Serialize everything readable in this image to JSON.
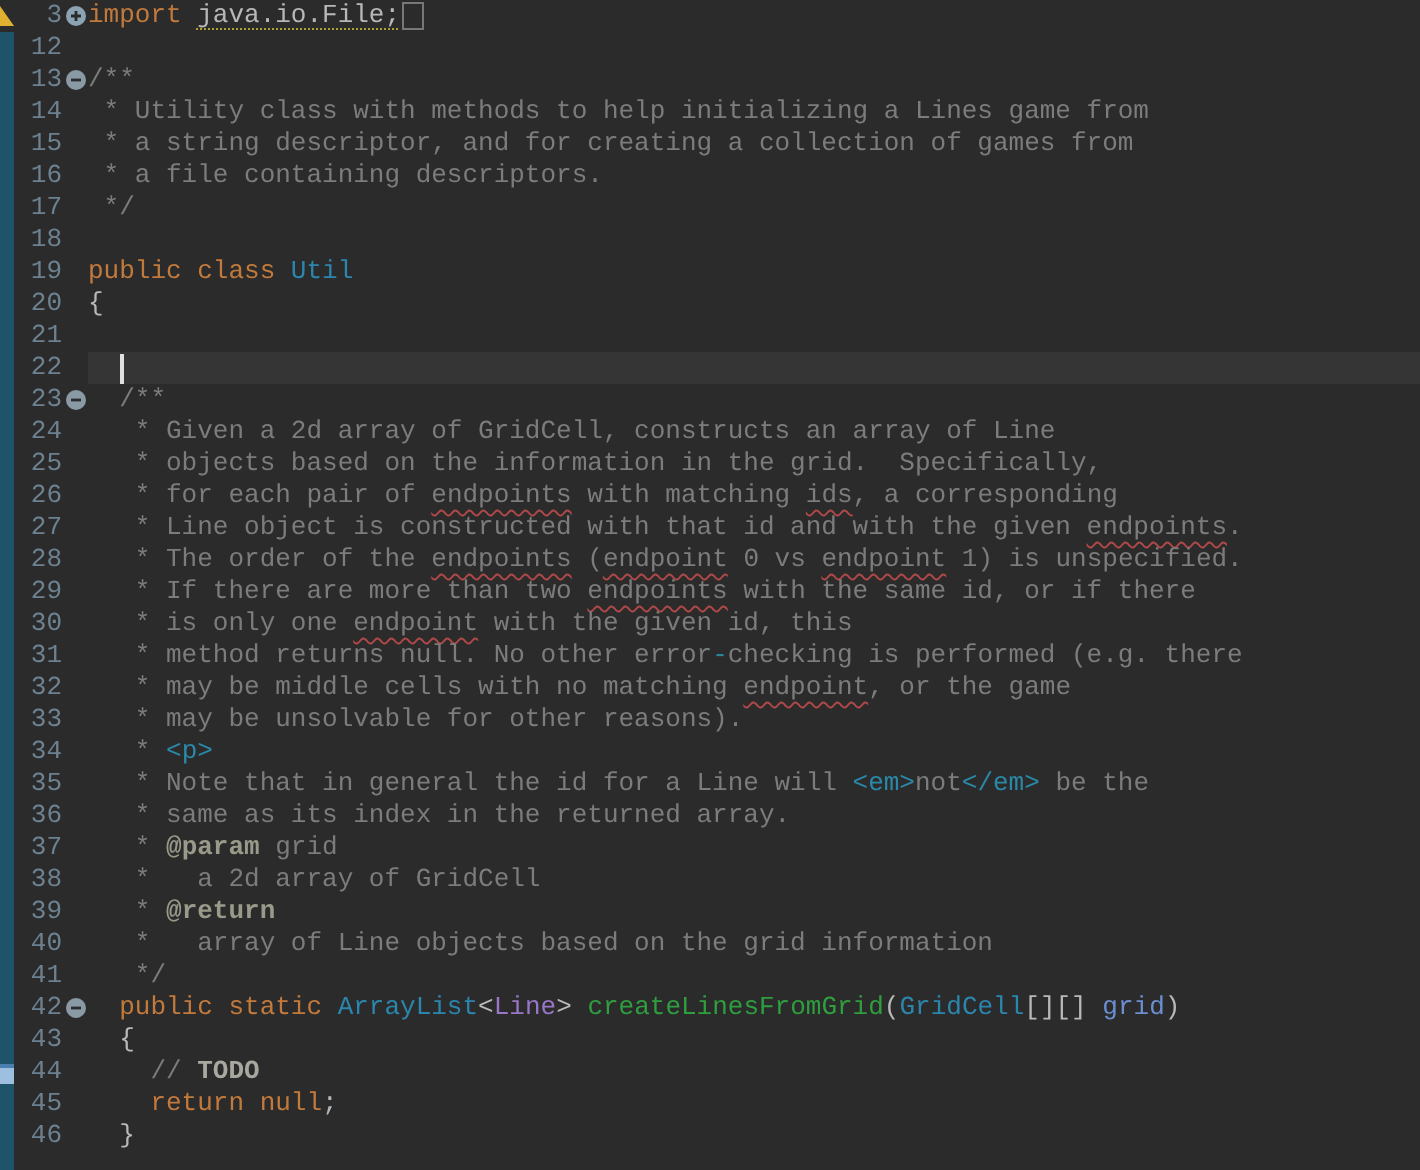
{
  "editor": {
    "lines": [
      {
        "number": "3",
        "folded": true,
        "annotation": {
          "kind": "warning"
        },
        "current": false,
        "tokens": [
          {
            "kind": "keyword",
            "text": "import "
          },
          {
            "kind": "warning",
            "text": "java.io.File;"
          }
        ]
      },
      {
        "number": "12",
        "current": false
      },
      {
        "number": "13",
        "folded": false,
        "current": false,
        "tokens": [
          {
            "kind": "comment",
            "text": "/**"
          }
        ]
      },
      {
        "number": "14",
        "current": false,
        "tokens": [
          {
            "kind": "comment",
            "text": " * Utility class with methods to help initializing a Lines game from"
          }
        ]
      },
      {
        "number": "15",
        "current": false,
        "tokens": [
          {
            "kind": "comment",
            "text": " * a string descriptor, and for creating a collection of games from"
          }
        ]
      },
      {
        "number": "16",
        "current": false,
        "tokens": [
          {
            "kind": "comment",
            "text": " * a file containing descriptors."
          }
        ]
      },
      {
        "number": "17",
        "current": false,
        "tokens": [
          {
            "kind": "comment",
            "text": " */"
          }
        ]
      },
      {
        "number": "18",
        "current": false
      },
      {
        "number": "19",
        "current": false,
        "tokens": [
          {
            "kind": "keyword",
            "text": "public class "
          },
          {
            "kind": "type",
            "text": "Util"
          }
        ]
      },
      {
        "number": "20",
        "current": false,
        "tokens": [
          {
            "kind": "plain",
            "text": "{"
          }
        ]
      },
      {
        "number": "21",
        "current": false
      },
      {
        "number": "22",
        "current": true
      },
      {
        "number": "23",
        "folded": false,
        "current": false,
        "tokens": [
          {
            "kind": "comment",
            "text": "  /**"
          }
        ]
      },
      {
        "number": "24",
        "current": false,
        "tokens": [
          {
            "kind": "comment",
            "text": "   * Given a 2d array of GridCell, constructs an array of Line"
          }
        ]
      },
      {
        "number": "25",
        "current": false,
        "tokens": [
          {
            "kind": "comment",
            "text": "   * objects based on the information in the grid.  Specifically,"
          }
        ]
      },
      {
        "number": "26",
        "current": false,
        "tokens": [
          {
            "kind": "comment",
            "text": "   * for each pair of "
          },
          {
            "kind": "misspelled",
            "text": "endpoints"
          },
          {
            "kind": "comment",
            "text": " with matching "
          },
          {
            "kind": "misspelled",
            "text": "ids"
          },
          {
            "kind": "comment",
            "text": ", a corresponding"
          }
        ]
      },
      {
        "number": "27",
        "current": false,
        "tokens": [
          {
            "kind": "comment",
            "text": "   * Line object is constructed with that id and with the given "
          },
          {
            "kind": "misspelled",
            "text": "endpoints"
          },
          {
            "kind": "comment",
            "text": "."
          }
        ]
      },
      {
        "number": "28",
        "current": false,
        "tokens": [
          {
            "kind": "comment",
            "text": "   * The order of the "
          },
          {
            "kind": "misspelled",
            "text": "endpoints"
          },
          {
            "kind": "comment",
            "text": " ("
          },
          {
            "kind": "misspelled",
            "text": "endpoint"
          },
          {
            "kind": "comment",
            "text": " 0 vs "
          },
          {
            "kind": "misspelled",
            "text": "endpoint"
          },
          {
            "kind": "comment",
            "text": " 1) is unspecified."
          }
        ]
      },
      {
        "number": "29",
        "current": false,
        "tokens": [
          {
            "kind": "comment",
            "text": "   * If there are more than two "
          },
          {
            "kind": "misspelled",
            "text": "endpoints"
          },
          {
            "kind": "comment",
            "text": " with the same id, or if there"
          }
        ]
      },
      {
        "number": "30",
        "current": false,
        "tokens": [
          {
            "kind": "comment",
            "text": "   * is only one "
          },
          {
            "kind": "misspelled",
            "text": "endpoint"
          },
          {
            "kind": "comment",
            "text": " with the given id, this"
          }
        ]
      },
      {
        "number": "31",
        "current": false,
        "tokens": [
          {
            "kind": "comment",
            "text": "   * method returns null. No other error"
          },
          {
            "kind": "tag",
            "text": "-"
          },
          {
            "kind": "comment",
            "text": "checking is performed (e.g. there"
          }
        ]
      },
      {
        "number": "32",
        "current": false,
        "tokens": [
          {
            "kind": "comment",
            "text": "   * may be middle cells with no matching "
          },
          {
            "kind": "misspelled",
            "text": "endpoint"
          },
          {
            "kind": "comment",
            "text": ", or the game"
          }
        ]
      },
      {
        "number": "33",
        "current": false,
        "tokens": [
          {
            "kind": "comment",
            "text": "   * may be unsolvable for other reasons)."
          }
        ]
      },
      {
        "number": "34",
        "current": false,
        "tokens": [
          {
            "kind": "comment",
            "text": "   * "
          },
          {
            "kind": "tag",
            "text": "<p>"
          }
        ]
      },
      {
        "number": "35",
        "current": false,
        "tokens": [
          {
            "kind": "comment",
            "text": "   * Note that in general the id for a Line will "
          },
          {
            "kind": "tag",
            "text": "<em>"
          },
          {
            "kind": "comment",
            "text": "not"
          },
          {
            "kind": "tag",
            "text": "</em>"
          },
          {
            "kind": "comment",
            "text": " be the"
          }
        ]
      },
      {
        "number": "36",
        "current": false,
        "tokens": [
          {
            "kind": "comment",
            "text": "   * same as its index in the returned array."
          }
        ]
      },
      {
        "number": "37",
        "current": false,
        "tokens": [
          {
            "kind": "comment",
            "text": "   * "
          },
          {
            "kind": "doctag",
            "text": "@param"
          },
          {
            "kind": "comment",
            "text": " grid"
          }
        ]
      },
      {
        "number": "38",
        "current": false,
        "tokens": [
          {
            "kind": "comment",
            "text": "   *   a 2d array of GridCell"
          }
        ]
      },
      {
        "number": "39",
        "current": false,
        "tokens": [
          {
            "kind": "comment",
            "text": "   * "
          },
          {
            "kind": "doctag",
            "text": "@return"
          }
        ]
      },
      {
        "number": "40",
        "current": false,
        "tokens": [
          {
            "kind": "comment",
            "text": "   *   array of Line objects based on the grid information"
          }
        ]
      },
      {
        "number": "41",
        "current": false,
        "tokens": [
          {
            "kind": "comment",
            "text": "   */"
          }
        ]
      },
      {
        "number": "42",
        "folded": false,
        "current": false,
        "tokens": [
          {
            "kind": "keyword",
            "text": "  public static "
          },
          {
            "kind": "type",
            "text": "ArrayList"
          },
          {
            "kind": "plain",
            "text": "<"
          },
          {
            "kind": "typeparam",
            "text": "Line"
          },
          {
            "kind": "plain",
            "text": "> "
          },
          {
            "kind": "method",
            "text": "createLinesFromGrid"
          },
          {
            "kind": "plain",
            "text": "("
          },
          {
            "kind": "type",
            "text": "GridCell"
          },
          {
            "kind": "plain",
            "text": "[][] "
          },
          {
            "kind": "param",
            "text": "grid"
          },
          {
            "kind": "plain",
            "text": ")"
          }
        ]
      },
      {
        "number": "43",
        "current": false,
        "tokens": [
          {
            "kind": "plain",
            "text": "  {"
          }
        ]
      },
      {
        "number": "44",
        "annotation": {
          "kind": "task"
        },
        "current": false,
        "tokens": [
          {
            "kind": "comment",
            "text": "    // "
          },
          {
            "kind": "task",
            "text": "TODO"
          }
        ]
      },
      {
        "number": "45",
        "current": false,
        "tokens": [
          {
            "kind": "keyword",
            "text": "    return null"
          },
          {
            "kind": "plain",
            "text": ";"
          }
        ]
      },
      {
        "number": "46",
        "current": false,
        "tokens": [
          {
            "kind": "plain",
            "text": "  }"
          }
        ]
      }
    ]
  }
}
